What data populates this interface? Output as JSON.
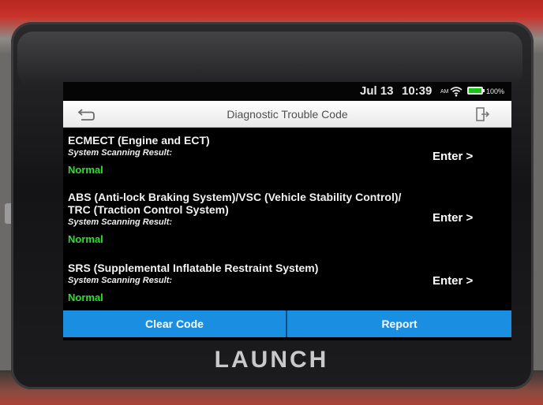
{
  "status_bar": {
    "date": "Jul 13",
    "time": "10:39",
    "am_pm": "AM",
    "battery": "100%"
  },
  "header": {
    "title": "Diagnostic Trouble Code",
    "back_icon": "back-arrow-icon",
    "exit_icon": "exit-icon"
  },
  "systems": [
    {
      "name": "ECMECT (Engine and ECT)",
      "scan_label": "System Scanning Result:",
      "result": "Normal",
      "enter_label": "Enter >"
    },
    {
      "name": "ABS (Anti-lock Braking System)/VSC (Vehicle Stability Control)/ TRC (Traction Control System)",
      "scan_label": "System Scanning Result:",
      "result": "Normal",
      "enter_label": "Enter >"
    },
    {
      "name": "SRS (Supplemental Inflatable Restraint System)",
      "scan_label": "System Scanning Result:",
      "result": "Normal",
      "enter_label": "Enter >"
    }
  ],
  "actions": {
    "clear_code": "Clear Code",
    "report": "Report"
  },
  "brand": "LAUNCH",
  "colors": {
    "button_blue": "#1a8ee0",
    "result_green": "#2ee02e",
    "battery_green": "#17c417"
  }
}
